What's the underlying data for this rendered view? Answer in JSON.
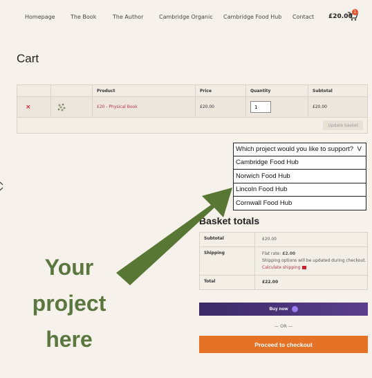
{
  "nav": {
    "items": [
      "Homepage",
      "The Book",
      "The Author",
      "Cambridge Organic",
      "Cambridge Food Hub",
      "Contact"
    ],
    "cart_total": "£20.00",
    "cart_count": "1"
  },
  "page_title": "Cart",
  "cart_table": {
    "headers": [
      "",
      "",
      "Product",
      "Price",
      "Quantity",
      "Subtotal"
    ],
    "rows": [
      {
        "remove": "×",
        "product": "£20 - Physical Book",
        "price": "£20.00",
        "quantity": "1",
        "subtotal": "£20.00"
      }
    ],
    "update_label": "Update basket"
  },
  "dropdown": {
    "placeholder": "Which project would you like to support?",
    "caret": "V",
    "options": [
      "Cambridge Food Hub",
      "Norwich Food Hub",
      "Lincoln Food Hub",
      "Cornwall Food Hub"
    ]
  },
  "totals": {
    "title": "Basket totals",
    "subtotal_label": "Subtotal",
    "subtotal_value": "£20.00",
    "shipping_label": "Shipping",
    "shipping_rate_prefix": "Flat rate:",
    "shipping_rate_value": "£2.00",
    "shipping_note": "Shipping options will be updated during checkout.",
    "calc_shipping": "Calculate shipping",
    "total_label": "Total",
    "total_value": "£22.00"
  },
  "buy_now_label": "Buy now",
  "or_label": "— OR —",
  "checkout_label": "Proceed to checkout",
  "promo": [
    "Your",
    "project",
    "here"
  ],
  "colors": {
    "background": "#f6f1ea",
    "accent_red": "#b4374f",
    "arrow_green": "#587735",
    "checkout_orange": "#e67226",
    "buy_purple": "#3b2a66"
  },
  "icons": {
    "cart": "cart-icon",
    "remove": "remove-icon",
    "shipping": "shipping-icon"
  }
}
